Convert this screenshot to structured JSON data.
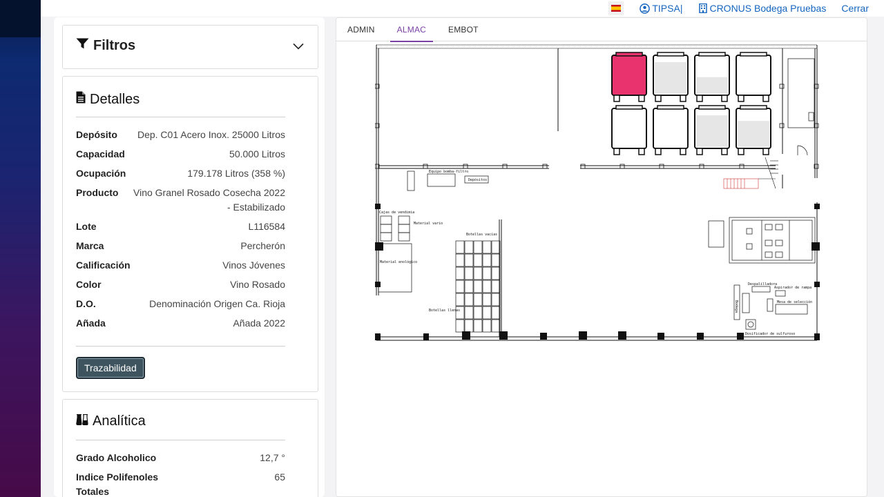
{
  "topbar": {
    "language_flag": "es-flag-icon",
    "user_label": "TIPSA|",
    "company_label": "CRONUS Bodega Pruebas",
    "logout_label": "Cerrar"
  },
  "filtros": {
    "title": "Filtros"
  },
  "detalles": {
    "title": "Detalles",
    "rows": [
      {
        "label": "Depósito",
        "value": "Dep. C01 Acero Inox. 25000 Litros"
      },
      {
        "label": "Capacidad",
        "value": "50.000 Litros"
      },
      {
        "label": "Ocupación",
        "value": "179.178 Litros (358 %)"
      },
      {
        "label": "Producto",
        "value": "Vino Granel Rosado Cosecha 2022 - Estabilizado"
      },
      {
        "label": "Lote",
        "value": "L116584"
      },
      {
        "label": "Marca",
        "value": "Percherón"
      },
      {
        "label": "Calificación",
        "value": "Vinos Jóvenes"
      },
      {
        "label": "Color",
        "value": "Vino Rosado"
      },
      {
        "label": "D.O.",
        "value": "Denominación Origen Ca. Rioja"
      },
      {
        "label": "Añada",
        "value": "Añada 2022"
      }
    ],
    "button_label": "Trazabilidad"
  },
  "analitica": {
    "title": "Analítica",
    "rows": [
      {
        "label": "Grado Alcoholico",
        "value": "12,7 °"
      },
      {
        "label": "Indice Polifenoles Totales",
        "value": "65"
      }
    ]
  },
  "tabs": [
    {
      "label": "ADMIN",
      "active": false
    },
    {
      "label": "ALMAC",
      "active": true
    },
    {
      "label": "EMBOT",
      "active": false
    }
  ],
  "plan": {
    "labels": {
      "cajas": "Cajas de vendimia",
      "material_vario": "Material vario",
      "material_enologico": "Material enológico",
      "botellas_vacias": "Botellas vacías",
      "botellas_llenas": "Botellas llenas",
      "equipo": "Equipo bomba-filtro",
      "depositos": "Depósitos",
      "despalilladora": "Despalilladora",
      "aspirador": "Aspirador de rampa",
      "mesa": "Mesa de selección",
      "dosificador": "Dosificador de sulfuroso",
      "bodega": "Bodega"
    },
    "selected_tank_color": "#e8336f",
    "tanks": [
      {
        "selected": true,
        "fill": 0.0
      },
      {
        "selected": false,
        "fill": 0.85
      },
      {
        "selected": false,
        "fill": 0.45
      },
      {
        "selected": false,
        "fill": 0.0
      },
      {
        "selected": false,
        "fill": 0.0
      },
      {
        "selected": false,
        "fill": 0.0
      },
      {
        "selected": false,
        "fill": 0.85
      },
      {
        "selected": false,
        "fill": 0.7
      }
    ]
  }
}
